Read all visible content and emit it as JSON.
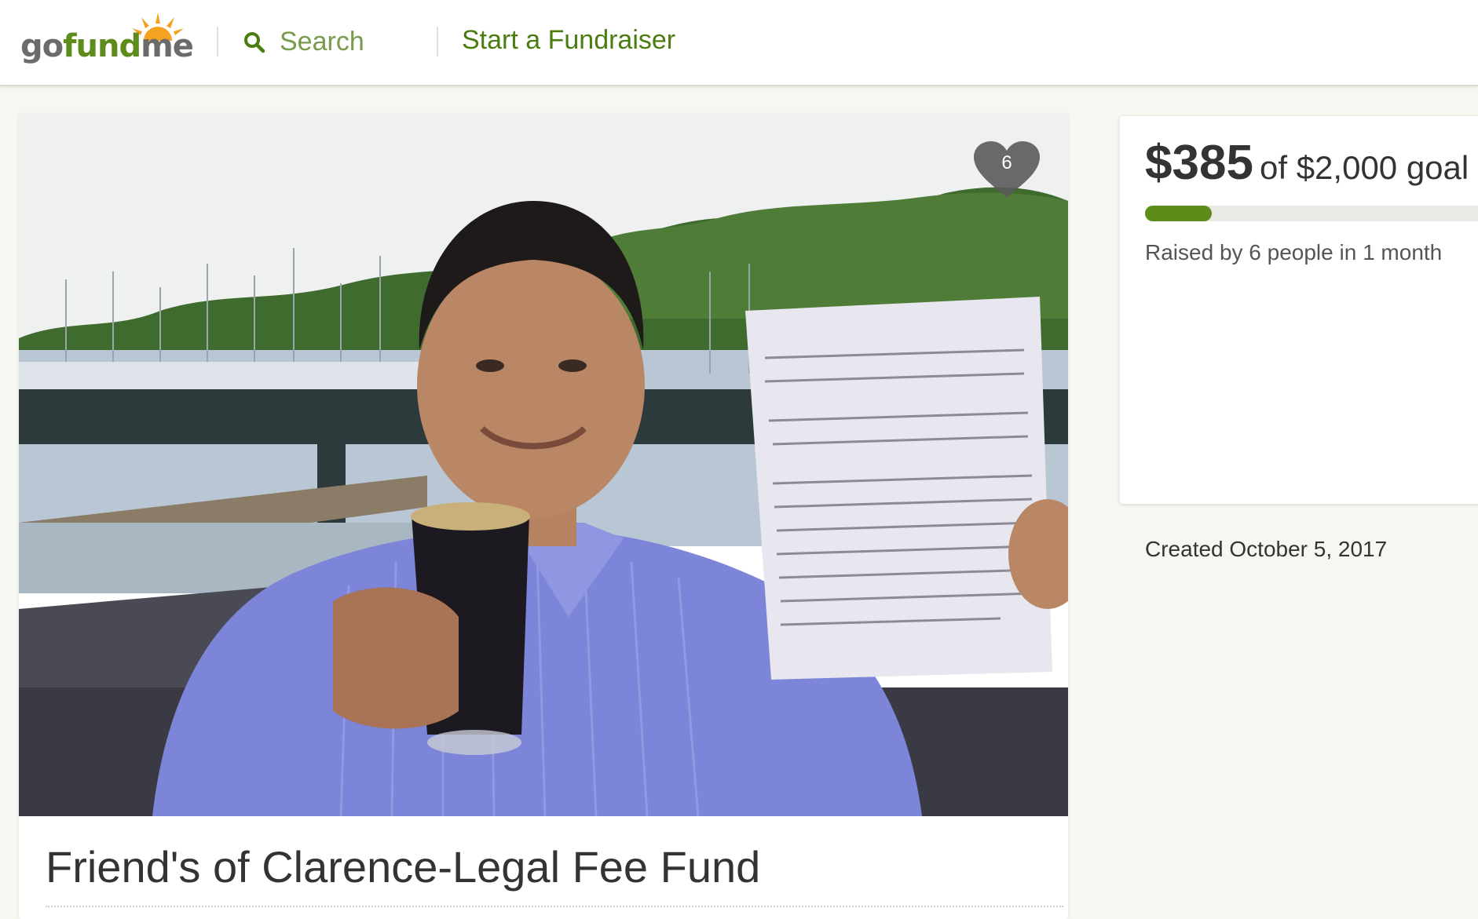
{
  "header": {
    "logo_prefix": "go",
    "logo_middle": "fund",
    "logo_suffix": "me",
    "search_label": "Search",
    "start_link": "Start a Fundraiser"
  },
  "campaign": {
    "heart_count": "6",
    "title": "Friend's of Clarence-Legal Fee Fund"
  },
  "donation_panel": {
    "raised": "$385",
    "goal_text": "of $2,000 goal",
    "progress_percent": 19.25,
    "raised_by": "Raised by 6 people in 1 month"
  },
  "created": "Created October 5, 2017",
  "colors": {
    "brand_green": "#5e8c1a",
    "link_green": "#4a7c10",
    "heart_gray": "#555555"
  },
  "icons": [
    "logo-sun-icon",
    "search-icon",
    "heart-icon"
  ]
}
